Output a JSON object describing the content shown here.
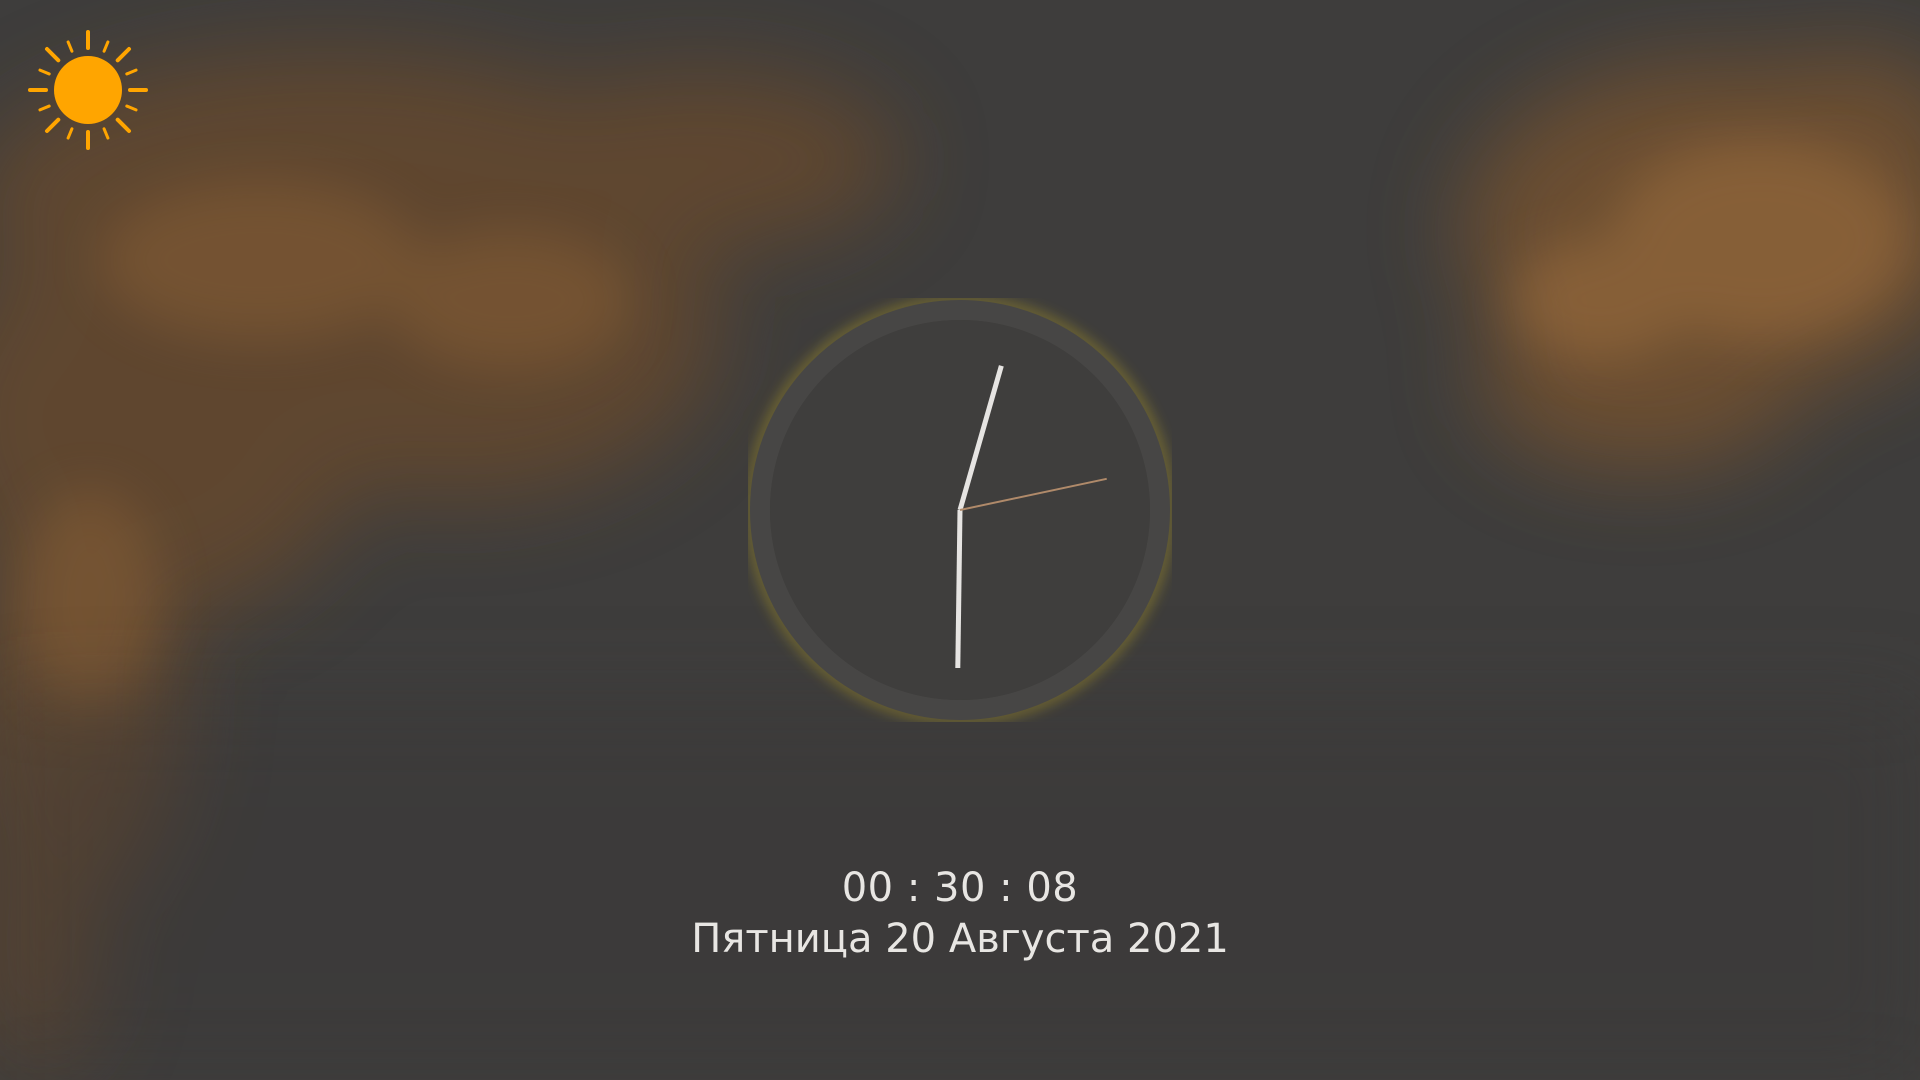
{
  "weather": {
    "icon": "sun-icon",
    "color": "#ffa500"
  },
  "clock": {
    "hours": 0,
    "minutes": 30,
    "seconds": 8,
    "hand_color": "#e6e4e2",
    "second_hand_color": "#b08a6a",
    "face_color": "#3f3e3d",
    "ring_color": "#474645",
    "glow_color": "#b5a022"
  },
  "digital_time": "00 : 30 : 08",
  "date": "Пятница 20 Августа 2021",
  "colors": {
    "background": "#3e3d3c",
    "smoke": "#8a5a2a",
    "text": "#e8e6e3"
  }
}
